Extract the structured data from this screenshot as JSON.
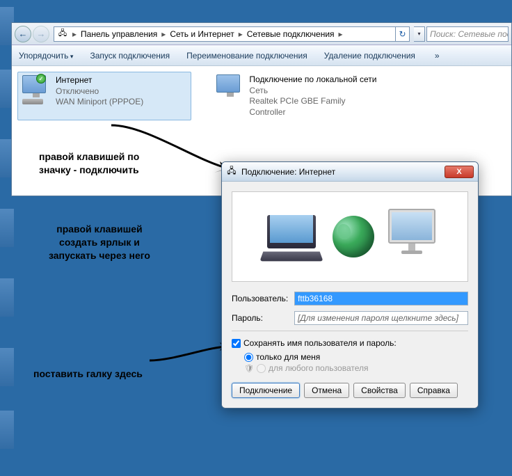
{
  "explorer": {
    "breadcrumb": [
      "Панель управления",
      "Сеть и Интернет",
      "Сетевые подключения"
    ],
    "search_placeholder": "Поиск: Сетевые под",
    "toolbar": {
      "organize": "Упорядочить",
      "start": "Запуск подключения",
      "rename": "Переименование подключения",
      "delete": "Удаление подключения",
      "more": "»"
    },
    "connections": [
      {
        "name": "Интернет",
        "status": "Отключено",
        "device": "WAN Miniport (PPPOE)",
        "selected": true,
        "badge": "✓"
      },
      {
        "name": "Подключение по локальной сети",
        "status": "Сеть",
        "device": "Realtek PCIe GBE Family Controller",
        "selected": false
      }
    ]
  },
  "annotations": {
    "a1": "правой клавишей по\nзначку - подключить",
    "a2": "правой клавишей\nсоздать ярлык и\nзапускать через него",
    "a3": "поставить галку здесь"
  },
  "dialog": {
    "title": "Подключение: Интернет",
    "close": "X",
    "user_label": "Пользователь:",
    "user_value": "fttb36168",
    "pass_label": "Пароль:",
    "pass_placeholder": "[Для изменения пароля щелкните здесь]",
    "save_label": "Сохранять имя пользователя и пароль:",
    "opt_me": "только для меня",
    "opt_any": "для любого пользователя",
    "buttons": {
      "connect": "Подключение",
      "cancel": "Отмена",
      "props": "Свойства",
      "help": "Справка"
    }
  }
}
